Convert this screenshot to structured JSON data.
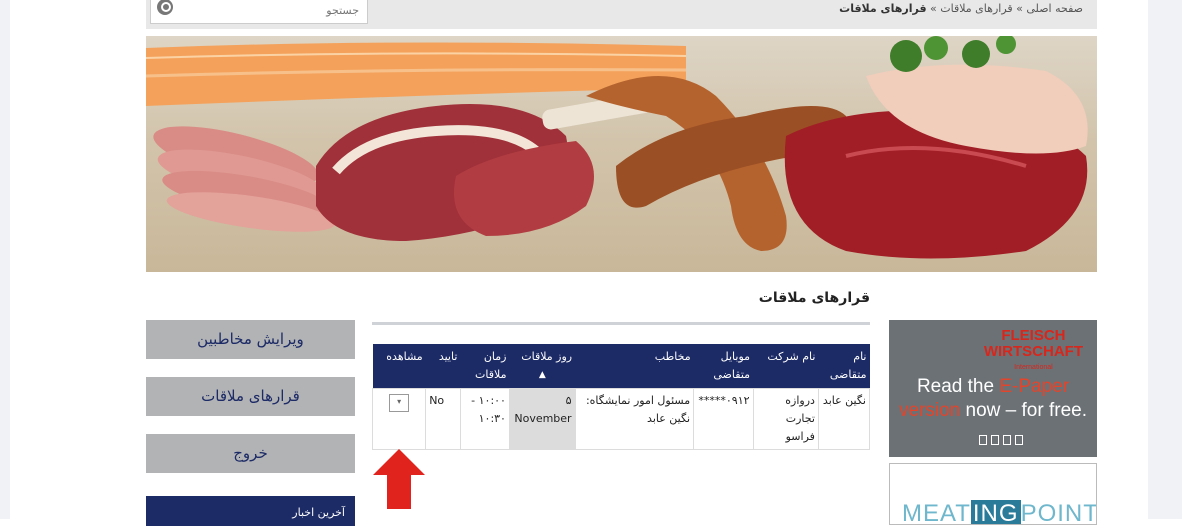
{
  "breadcrumb": {
    "home": "صفحه اصلی",
    "separator1": "»",
    "meetings": "قرارهای ملاقات",
    "separator2": "»",
    "current": "قرارهای ملاقات"
  },
  "search": {
    "placeholder": "جستجو"
  },
  "page_title": "قرارهای ملاقات",
  "table": {
    "headers": {
      "name": "نام متقاضی",
      "company": "نام شرکت",
      "mobile": "موبایل متقاضی",
      "contact": "مخاطب",
      "day": "روز ملاقات",
      "time": "زمان ملاقات",
      "confirm": "تایید",
      "view": "مشاهده"
    },
    "sort_indicator": "▲",
    "rows": [
      {
        "name": "نگین عابد",
        "company": "دروازه تجارت فراسو",
        "mobile": "*****۰۹۱۲",
        "contact": "مسئول امور نمایشگاه: نگین عابد",
        "day": "۵ November",
        "time": "۱۰:۰۰ - ۱۰:۳۰",
        "confirm": "No",
        "view_icon": "▾"
      }
    ]
  },
  "menu": {
    "edit_contacts": "ویرایش مخاطبین",
    "meetings": "قرارهای ملاقات",
    "logout": "خروج",
    "latest_news": "آخرین اخبار"
  },
  "ads": {
    "fleisch": {
      "brand_line1": "FLEISCH",
      "brand_line2": "WIRTSCHAFT",
      "brand_sub": "International",
      "read_the": "Read the",
      "e_paper": "E-Paper",
      "version": "version",
      "now_free": "now – for free."
    },
    "meatingpoint": {
      "part1": "MEAT",
      "part2": "ING",
      "part3": "POINT"
    }
  },
  "colors": {
    "navy": "#1c2a66",
    "menu_gray": "#b2b3b5",
    "arrow_red": "#e0231c"
  }
}
